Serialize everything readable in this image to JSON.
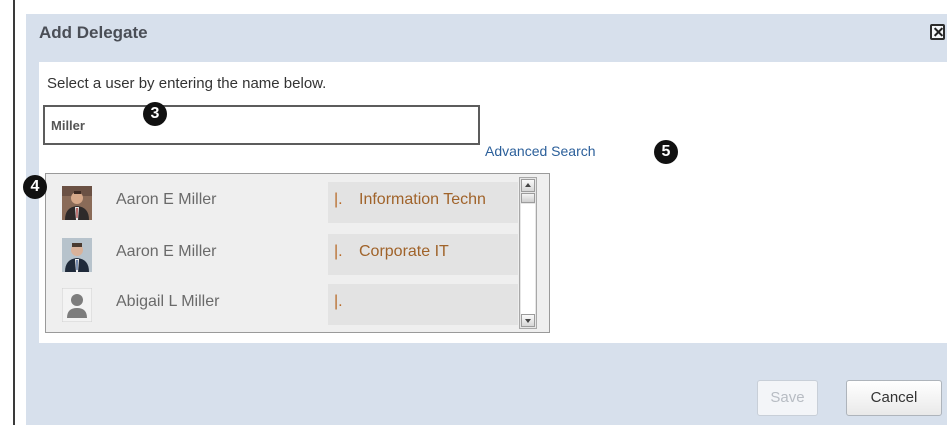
{
  "dialog": {
    "title": "Add Delegate",
    "instruction": "Select a user by entering the name below.",
    "search": {
      "value": "Miller"
    },
    "advanced_search": "Advanced Search",
    "results": [
      {
        "name": "Aaron E Miller",
        "separator": "|.",
        "department": "Information Techn",
        "avatar": "photo-avatar-man-1"
      },
      {
        "name": "Aaron E Miller",
        "separator": "|.",
        "department": "Corporate IT",
        "avatar": "photo-avatar-man-2"
      },
      {
        "name": "Abigail L Miller",
        "separator": "|.",
        "department": "",
        "avatar": "generic-person-icon"
      }
    ],
    "buttons": {
      "save": "Save",
      "cancel": "Cancel"
    }
  },
  "callouts": {
    "input": "3",
    "first_result": "4",
    "advanced_search": "5"
  },
  "colors": {
    "dialog_bg": "#d7e0ec",
    "link": "#2b5f9a",
    "department_text": "#a0632a"
  }
}
